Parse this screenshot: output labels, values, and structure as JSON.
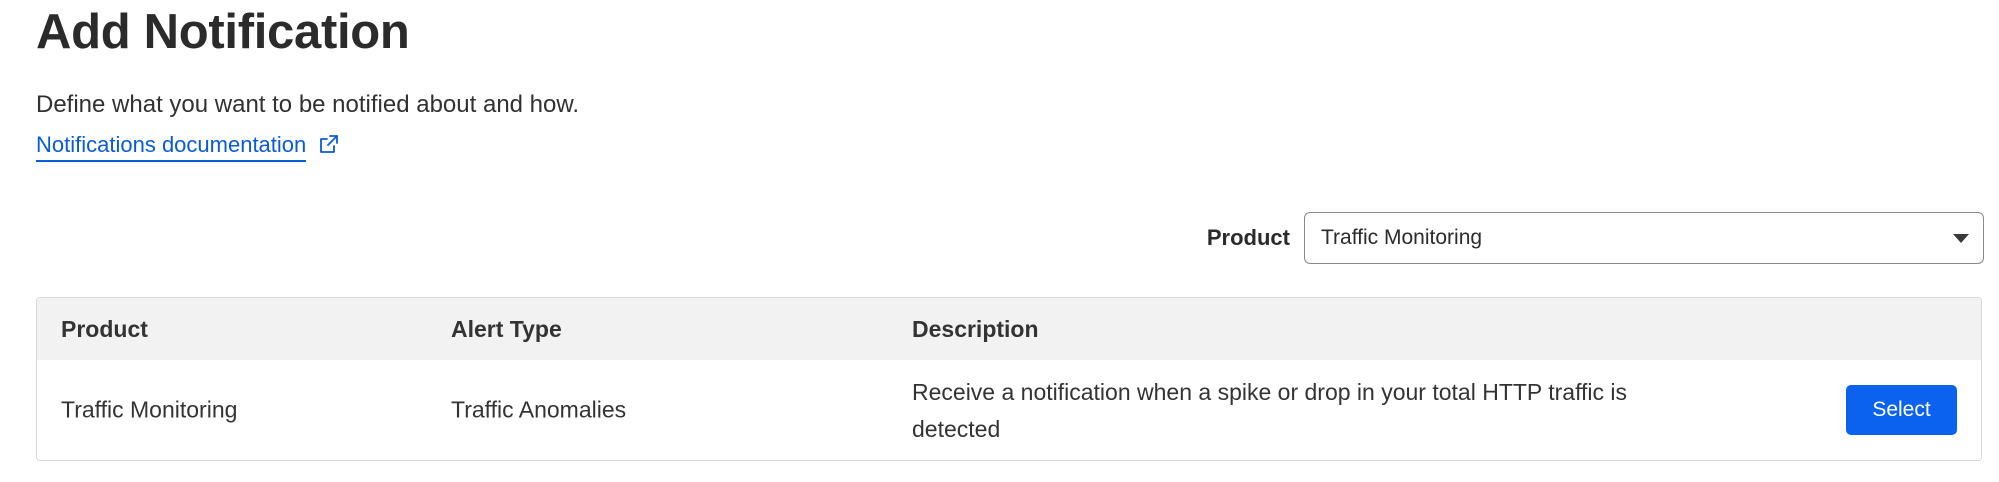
{
  "header": {
    "title": "Add Notification",
    "subtitle": "Define what you want to be notified about and how.",
    "doc_link": {
      "label": "Notifications documentation",
      "icon": "external-link-icon"
    }
  },
  "filter": {
    "label": "Product",
    "selected": "Traffic Monitoring",
    "icon": "chevron-down-icon"
  },
  "table": {
    "columns": [
      "Product",
      "Alert Type",
      "Description"
    ],
    "rows": [
      {
        "product": "Traffic Monitoring",
        "alert_type": "Traffic Anomalies",
        "description": "Receive a notification when a spike or drop in your total HTTP traffic is detected",
        "action_label": "Select"
      }
    ]
  },
  "colors": {
    "link": "#0a5bd6",
    "primary_button": "#0a62ef",
    "header_bg": "#f2f2f2"
  }
}
